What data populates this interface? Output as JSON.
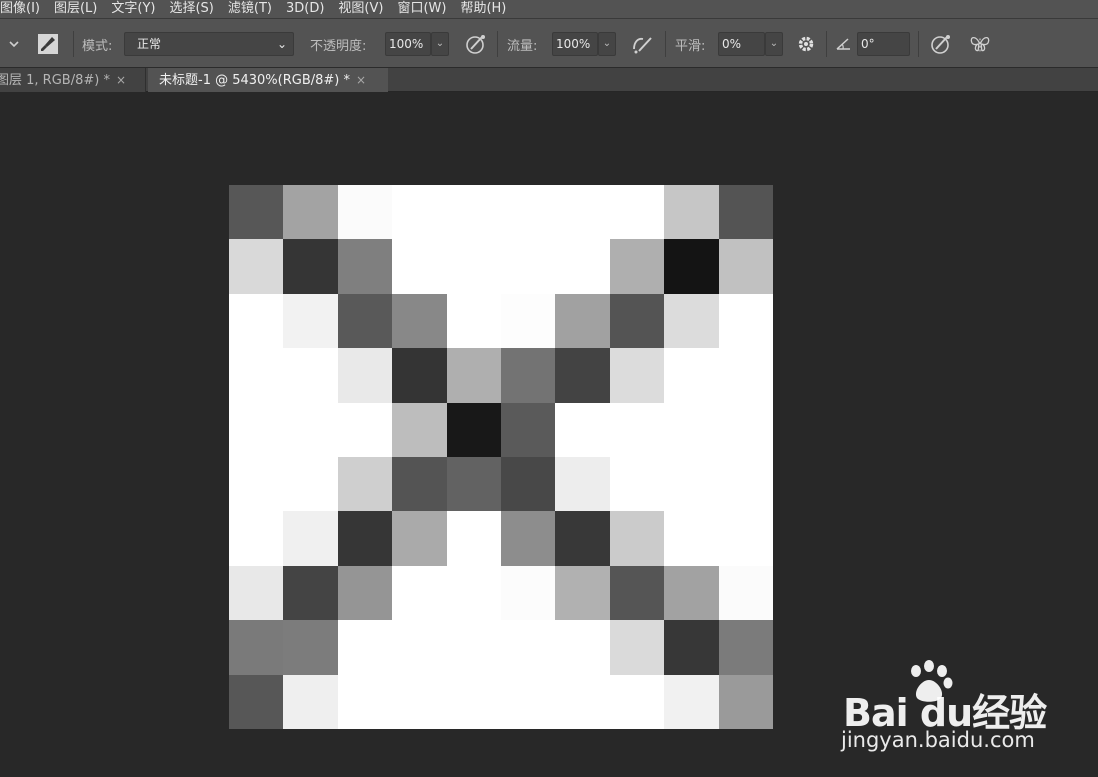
{
  "menu": [
    "图像(I)",
    "图层(L)",
    "文字(Y)",
    "选择(S)",
    "滤镜(T)",
    "3D(D)",
    "视图(V)",
    "窗口(W)",
    "帮助(H)"
  ],
  "options": {
    "mode_label": "模式:",
    "mode_value": "正常",
    "opacity_label": "不透明度:",
    "opacity_value": "100%",
    "flow_label": "流量:",
    "flow_value": "100%",
    "smooth_label": "平滑:",
    "smooth_value": "0%",
    "angle_value": "0°"
  },
  "tabs": [
    {
      "label": "图层 1, RGB/8#) *",
      "close": "×"
    },
    {
      "label": "未标题-1 @ 5430%(RGB/8#) *",
      "close": "×"
    }
  ],
  "pixel_grid": [
    [
      "#575757",
      "#a3a3a3",
      "#fbfbfb",
      "#ffffff",
      "#ffffff",
      "#ffffff",
      "#ffffff",
      "#ffffff",
      "#c6c6c6",
      "#545454"
    ],
    [
      "#d9d9d9",
      "#353535",
      "#7f7f7f",
      "#ffffff",
      "#ffffff",
      "#ffffff",
      "#ffffff",
      "#afafaf",
      "#141414",
      "#c1c1c1"
    ],
    [
      "#ffffff",
      "#f2f2f2",
      "#595959",
      "#888888",
      "#ffffff",
      "#fdfdfd",
      "#a1a1a1",
      "#545454",
      "#dcdcdc",
      "#ffffff"
    ],
    [
      "#ffffff",
      "#ffffff",
      "#e9e9e9",
      "#343434",
      "#afafaf",
      "#737373",
      "#434343",
      "#dcdcdc",
      "#ffffff",
      "#ffffff"
    ],
    [
      "#ffffff",
      "#ffffff",
      "#ffffff",
      "#bdbdbd",
      "#181818",
      "#5a5a5a",
      "#ffffff",
      "#ffffff",
      "#ffffff",
      "#ffffff"
    ],
    [
      "#ffffff",
      "#ffffff",
      "#cfcfcf",
      "#545454",
      "#626262",
      "#484848",
      "#ededed",
      "#ffffff",
      "#ffffff",
      "#ffffff"
    ],
    [
      "#ffffff",
      "#f0f0f0",
      "#363636",
      "#aaaaaa",
      "#ffffff",
      "#8d8d8d",
      "#383838",
      "#cbcbcb",
      "#ffffff",
      "#ffffff"
    ],
    [
      "#e8e8e8",
      "#444444",
      "#959595",
      "#ffffff",
      "#ffffff",
      "#fcfcfc",
      "#b1b1b1",
      "#555555",
      "#a2a2a2",
      "#fbfbfb"
    ],
    [
      "#7a7a7a",
      "#7c7c7c",
      "#ffffff",
      "#ffffff",
      "#ffffff",
      "#ffffff",
      "#ffffff",
      "#dadada",
      "#373737",
      "#7b7b7b"
    ],
    [
      "#575757",
      "#efefef",
      "#ffffff",
      "#ffffff",
      "#ffffff",
      "#ffffff",
      "#ffffff",
      "#ffffff",
      "#f1f1f1",
      "#9a9a9a"
    ]
  ],
  "watermark": {
    "brand": "Bai  du经验",
    "url": "jingyan.baidu.com"
  },
  "icons": [
    "chevron-down-icon",
    "brush-tool-icon",
    "pressure-opacity-icon",
    "airbrush-icon",
    "gear-icon",
    "angle-icon",
    "pressure-size-icon",
    "symmetry-butterfly-icon",
    "close-icon",
    "baidu-paw-icon"
  ]
}
